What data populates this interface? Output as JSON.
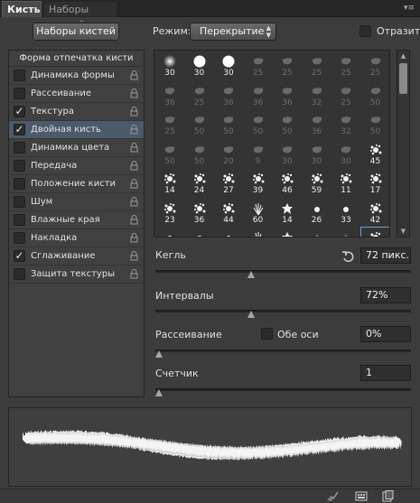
{
  "tabs": [
    {
      "label": "Кисть",
      "active": true
    },
    {
      "label": "Наборы кистей",
      "active": false
    }
  ],
  "toolbar": {
    "presets_button": "Наборы кистей",
    "mode_label": "Режим:",
    "mode_value": "Перекрытие",
    "flip_label": "Отразить",
    "flip_checked": false
  },
  "options": {
    "header": "Форма отпечатка кисти",
    "items": [
      {
        "label": "Динамика формы",
        "checked": false,
        "selected": false
      },
      {
        "label": "Рассеивание",
        "checked": false,
        "selected": false
      },
      {
        "label": "Текстура",
        "checked": true,
        "selected": false
      },
      {
        "label": "Двойная кисть",
        "checked": true,
        "selected": true
      },
      {
        "label": "Динамика цвета",
        "checked": false,
        "selected": false
      },
      {
        "label": "Передача",
        "checked": false,
        "selected": false
      },
      {
        "label": "Положение кисти",
        "checked": false,
        "selected": false
      },
      {
        "label": "Шум",
        "checked": false,
        "selected": false
      },
      {
        "label": "Влажные края",
        "checked": false,
        "selected": false
      },
      {
        "label": "Накладка",
        "checked": false,
        "selected": false
      },
      {
        "label": "Сглаживание",
        "checked": true,
        "selected": false
      },
      {
        "label": "Защита текстуры",
        "checked": false,
        "selected": false
      }
    ]
  },
  "brush_grid": {
    "rows": [
      [
        {
          "n": "30",
          "s": "lit",
          "k": "soft"
        },
        {
          "n": "30",
          "s": "lit",
          "k": "hard"
        },
        {
          "n": "30",
          "s": "lit",
          "k": "hard"
        },
        {
          "n": "25",
          "s": "faded",
          "k": "blob"
        },
        {
          "n": "25",
          "s": "faded",
          "k": "blob"
        },
        {
          "n": "25",
          "s": "faded",
          "k": "blob"
        },
        {
          "n": "25",
          "s": "faded",
          "k": "blob"
        },
        {
          "n": "25",
          "s": "faded",
          "k": "blob"
        }
      ],
      [
        {
          "n": "36",
          "s": "faded",
          "k": "blob"
        },
        {
          "n": "25",
          "s": "faded",
          "k": "blob"
        },
        {
          "n": "36",
          "s": "faded",
          "k": "blob"
        },
        {
          "n": "36",
          "s": "faded",
          "k": "blob"
        },
        {
          "n": "36",
          "s": "faded",
          "k": "blob"
        },
        {
          "n": "32",
          "s": "faded",
          "k": "blob"
        },
        {
          "n": "25",
          "s": "faded",
          "k": "blob"
        },
        {
          "n": "50",
          "s": "faded",
          "k": "blob"
        }
      ],
      [
        {
          "n": "25",
          "s": "faded",
          "k": "blob"
        },
        {
          "n": "50",
          "s": "faded",
          "k": "blob"
        },
        {
          "n": "50",
          "s": "faded",
          "k": "blob"
        },
        {
          "n": "50",
          "s": "faded",
          "k": "blob"
        },
        {
          "n": "50",
          "s": "faded",
          "k": "blob"
        },
        {
          "n": "36",
          "s": "faded",
          "k": "blob"
        },
        {
          "n": "32",
          "s": "faded",
          "k": "blob"
        },
        {
          "n": "50",
          "s": "faded",
          "k": "blob"
        }
      ],
      [
        {
          "n": "50",
          "s": "faded",
          "k": "blob"
        },
        {
          "n": "50",
          "s": "faded",
          "k": "blob"
        },
        {
          "n": "20",
          "s": "faded",
          "k": "blob"
        },
        {
          "n": "9",
          "s": "faded",
          "k": "blob"
        },
        {
          "n": "30",
          "s": "faded",
          "k": "blob"
        },
        {
          "n": "30",
          "s": "faded",
          "k": "blob"
        },
        {
          "n": "30",
          "s": "faded",
          "k": "blob"
        },
        {
          "n": "45",
          "s": "lit",
          "k": "splat"
        }
      ],
      [
        {
          "n": "14",
          "s": "lit",
          "k": "splat"
        },
        {
          "n": "24",
          "s": "lit",
          "k": "splat"
        },
        {
          "n": "27",
          "s": "lit",
          "k": "splat"
        },
        {
          "n": "39",
          "s": "lit",
          "k": "splat"
        },
        {
          "n": "46",
          "s": "lit",
          "k": "splat"
        },
        {
          "n": "59",
          "s": "lit",
          "k": "splat"
        },
        {
          "n": "11",
          "s": "lit",
          "k": "splat"
        },
        {
          "n": "17",
          "s": "lit",
          "k": "splat"
        }
      ],
      [
        {
          "n": "23",
          "s": "lit",
          "k": "splat"
        },
        {
          "n": "36",
          "s": "lit",
          "k": "splat"
        },
        {
          "n": "44",
          "s": "lit",
          "k": "splat"
        },
        {
          "n": "60",
          "s": "lit",
          "k": "grass"
        },
        {
          "n": "14",
          "s": "lit",
          "k": "star"
        },
        {
          "n": "26",
          "s": "lit",
          "k": "dot"
        },
        {
          "n": "33",
          "s": "lit",
          "k": "dot"
        },
        {
          "n": "42",
          "s": "lit",
          "k": "splat"
        }
      ],
      [
        {
          "n": "",
          "s": "lit",
          "k": "dot"
        },
        {
          "n": "",
          "s": "lit",
          "k": "dot"
        },
        {
          "n": "",
          "s": "lit",
          "k": "dot"
        },
        {
          "n": "",
          "s": "lit",
          "k": "grass"
        },
        {
          "n": "",
          "s": "lit",
          "k": "star"
        },
        {
          "n": "",
          "s": "faded",
          "k": "tri"
        },
        {
          "n": "",
          "s": "faded",
          "k": "tri"
        },
        {
          "n": "",
          "s": "lit",
          "k": "splat",
          "selected": true
        }
      ]
    ]
  },
  "size": {
    "label": "Кегль",
    "value": "72 пикс.",
    "slider": 0.42
  },
  "spacing": {
    "label": "Интервалы",
    "value": "72%",
    "slider": 0.42
  },
  "scatter": {
    "label": "Рассеивание",
    "both_axes_label": "Обе оси",
    "both_axes_checked": false,
    "value": "0%",
    "slider": 0.0
  },
  "count": {
    "label": "Счетчик",
    "value": "1",
    "slider": 0.0
  },
  "bottom_icons": [
    "brush-check-icon",
    "grid-panel-icon",
    "new-preset-icon"
  ]
}
